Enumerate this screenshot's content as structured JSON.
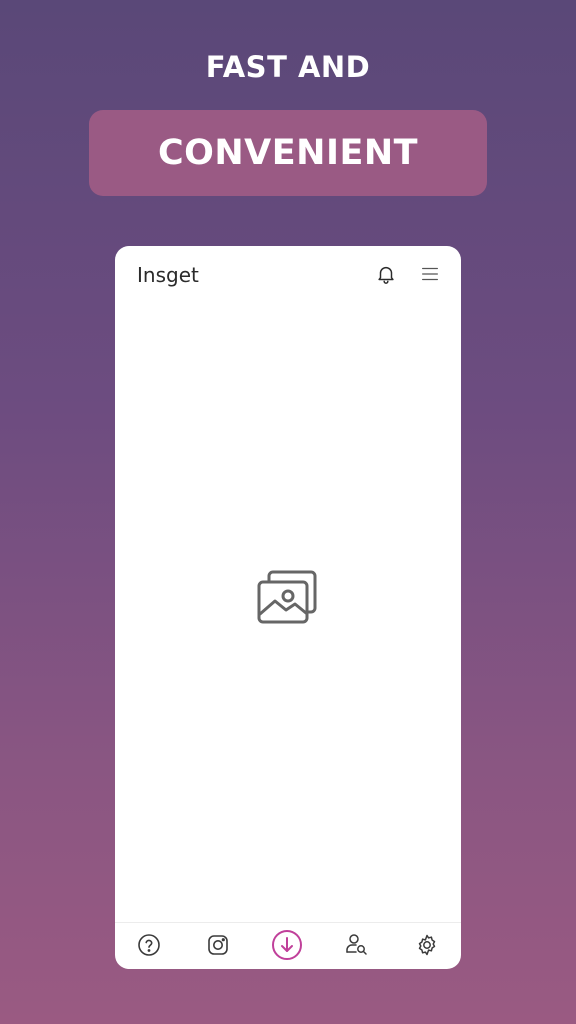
{
  "promo": {
    "line1": "FAST AND",
    "line2": "CONVENIENT"
  },
  "app": {
    "title": "Insget",
    "header_icons": [
      "bell-icon",
      "menu-icon"
    ],
    "content_placeholder_icon": "images-placeholder-icon",
    "bottom_nav": [
      {
        "name": "help",
        "icon": "question-circle-icon"
      },
      {
        "name": "instagram",
        "icon": "instagram-icon"
      },
      {
        "name": "download",
        "icon": "download-circle-icon",
        "active": true
      },
      {
        "name": "profile-search",
        "icon": "user-search-icon"
      },
      {
        "name": "settings",
        "icon": "gear-icon"
      }
    ],
    "colors": {
      "accent": "#c0409a",
      "icon": "#3a3a3a",
      "background_top": "#5a4878",
      "background_bottom": "#9a5a82"
    }
  }
}
